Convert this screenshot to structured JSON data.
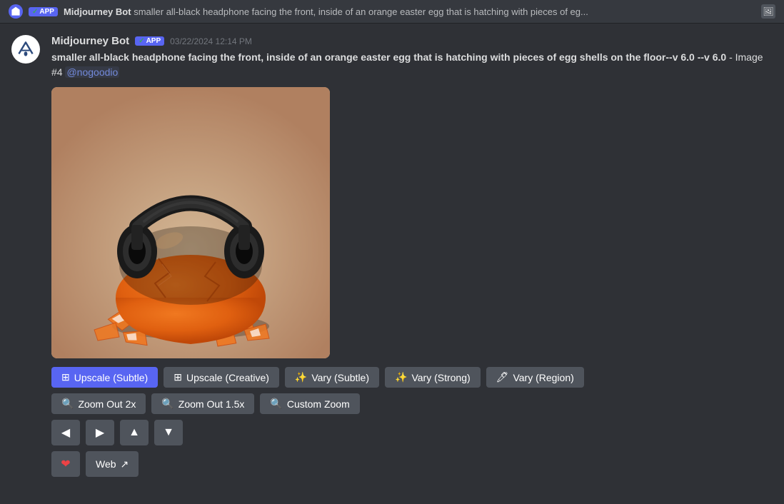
{
  "colors": {
    "background": "#2f3136",
    "surface": "#36393f",
    "active_button": "#5865f2",
    "default_button": "#4f545c",
    "accent": "#5865f2",
    "text_primary": "#dcddde",
    "text_muted": "#72767d",
    "text_mention": "#7289da",
    "heart_color": "#ed4245"
  },
  "notification_bar": {
    "bot_name": "Midjourney Bot",
    "app_badge": "APP",
    "prompt_preview": "smaller all-black headphone facing the front, inside of an orange easter egg that is hatching with pieces of eg..."
  },
  "message": {
    "bot_name": "Midjourney Bot",
    "app_badge": "APP",
    "timestamp": "03/22/2024 12:14 PM",
    "prompt_text": "smaller all-black headphone facing the front, inside of an orange easter egg that is hatching with pieces of egg shells on the floor--v 6.0 --v 6.0",
    "image_label": "- Image #4",
    "mention": "@nogoodio"
  },
  "buttons": {
    "row1": [
      {
        "id": "upscale-subtle",
        "label": "Upscale (Subtle)",
        "icon": "⊞",
        "active": true
      },
      {
        "id": "upscale-creative",
        "label": "Upscale (Creative)",
        "icon": "⊞",
        "active": false
      },
      {
        "id": "vary-subtle",
        "label": "Vary (Subtle)",
        "icon": "✨",
        "active": false
      },
      {
        "id": "vary-strong",
        "label": "Vary (Strong)",
        "icon": "✨",
        "active": false
      },
      {
        "id": "vary-region",
        "label": "Vary (Region)",
        "icon": "🖊",
        "active": false
      }
    ],
    "row2": [
      {
        "id": "zoom-out-2x",
        "label": "Zoom Out 2x",
        "icon": "🔍",
        "active": false
      },
      {
        "id": "zoom-out-1-5x",
        "label": "Zoom Out 1.5x",
        "icon": "🔍",
        "active": false
      },
      {
        "id": "custom-zoom",
        "label": "Custom Zoom",
        "icon": "🔍",
        "active": false
      }
    ],
    "row3_arrows": [
      "←",
      "→",
      "↑",
      "↓"
    ],
    "row4": [
      {
        "id": "heart",
        "label": "❤",
        "type": "heart"
      },
      {
        "id": "web",
        "label": "Web",
        "icon": "↗",
        "type": "web"
      }
    ]
  }
}
